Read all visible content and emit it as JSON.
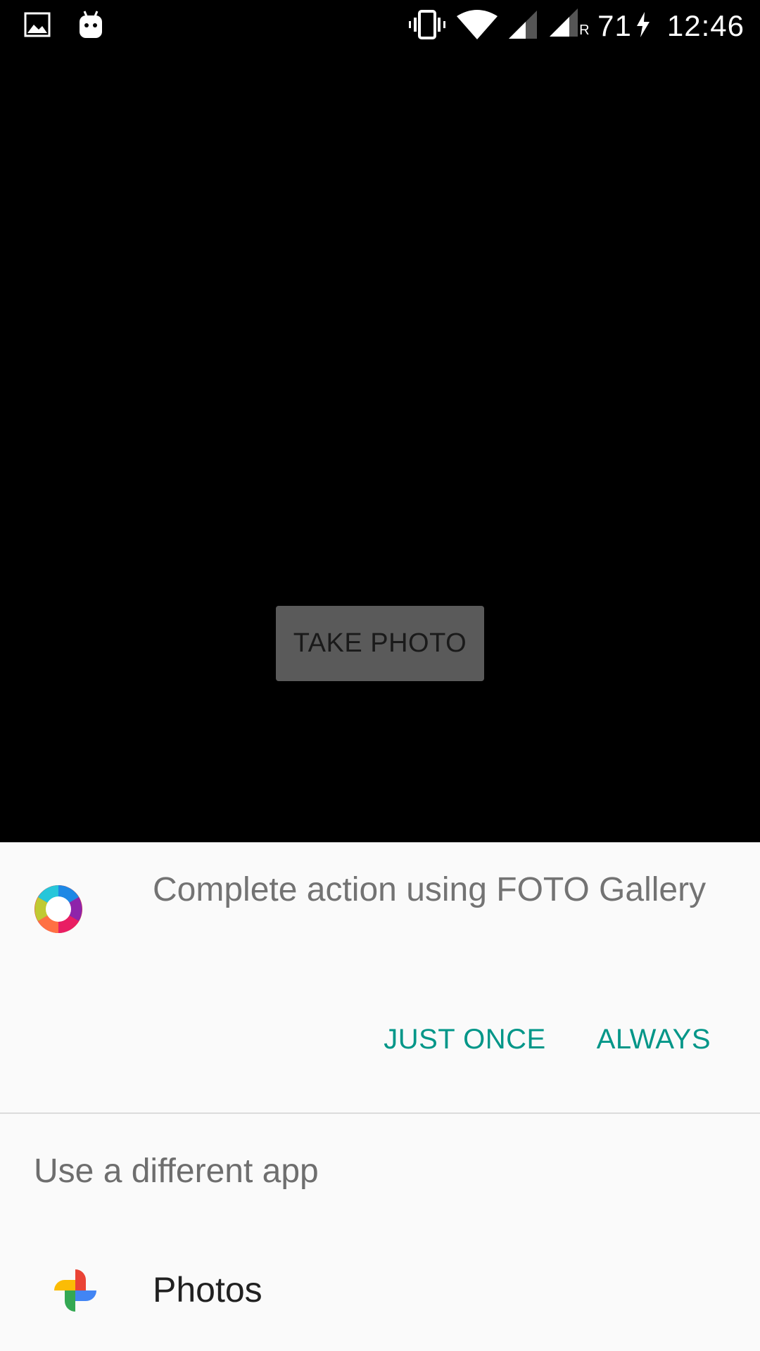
{
  "status_bar": {
    "time": "12:46",
    "battery": "71",
    "icons": [
      "gallery-notification-icon",
      "android-notification-icon",
      "vibrate-icon",
      "wifi-icon",
      "signal-icon",
      "roaming-signal-icon",
      "charging-icon"
    ],
    "roaming_label": "R"
  },
  "app": {
    "take_photo_label": "TAKE PHOTO"
  },
  "chooser": {
    "title": "Complete action using FOTO Gallery",
    "just_once_label": "JUST ONCE",
    "always_label": "ALWAYS",
    "subtitle": "Use a different app",
    "apps": [
      {
        "label": "Photos",
        "icon": "google-photos-icon"
      }
    ],
    "accent_color": "#009688"
  }
}
